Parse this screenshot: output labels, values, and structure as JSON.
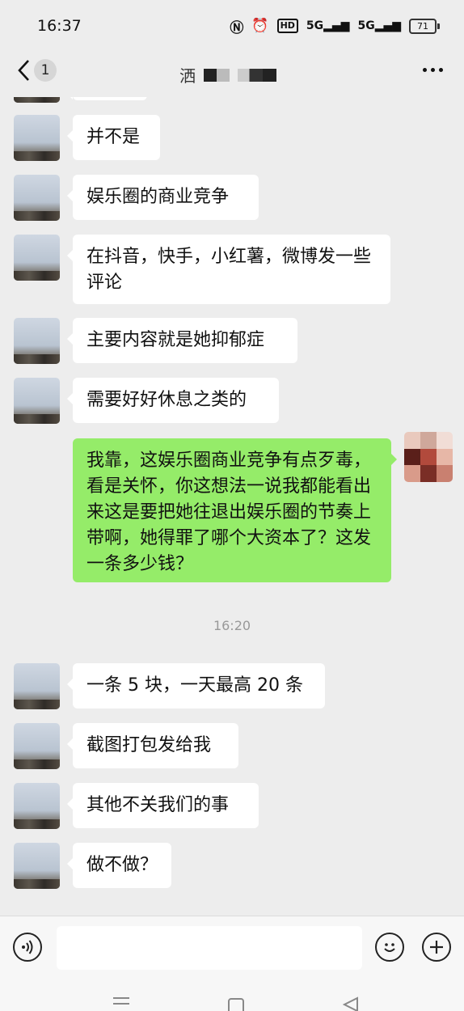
{
  "status_bar": {
    "time": "16:37",
    "network_1": "5G",
    "network_2": "5G",
    "hd": "HD",
    "battery": "71"
  },
  "nav": {
    "back_count": "1",
    "title": "洒"
  },
  "messages": [
    {
      "text": "并不是"
    },
    {
      "text": "娱乐圈的商业竞争"
    },
    {
      "text": "在抖音，快手，小红薯，微博发一些评论"
    },
    {
      "text": "主要内容就是她抑郁症"
    },
    {
      "text": "需要好好休息之类的"
    },
    {
      "text": "我靠，这娱乐圈商业竞争有点歹毒，看是关怀，你这想法一说我都能看出来这是要把她往退出娱乐圈的节奏上带啊，她得罪了哪个大资本了？这发一条多少钱？"
    },
    {
      "text": "一条 5 块，一天最高 20 条"
    },
    {
      "text": "截图打包发给我"
    },
    {
      "text": "其他不关我们的事"
    },
    {
      "text": "做不做？"
    }
  ],
  "timestamp": "16:20",
  "colors": {
    "self_bubble": "#95ec69",
    "other_bubble": "#ffffff",
    "background": "#ededed"
  },
  "icons": [
    "voice-icon",
    "emoji-icon",
    "plus-icon",
    "menu-icon",
    "home-icon",
    "back-nav-icon",
    "more-icon",
    "back-chevron-icon"
  ]
}
